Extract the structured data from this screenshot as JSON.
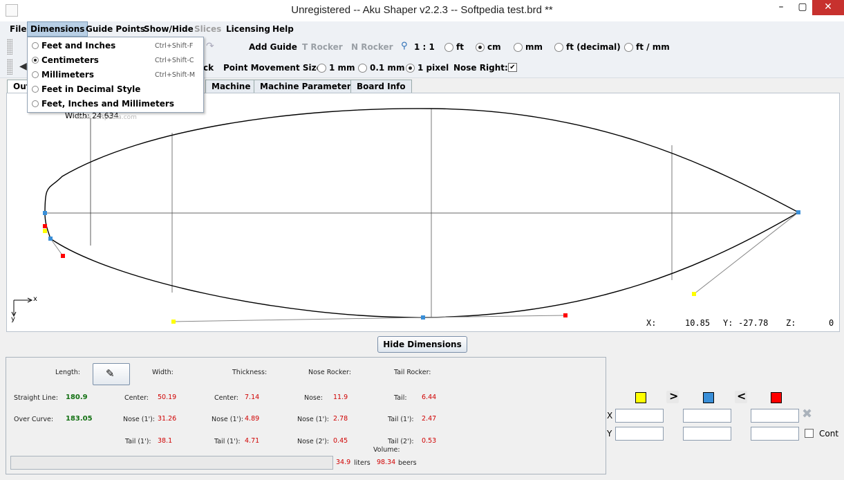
{
  "window": {
    "title": "Unregistered -- Aku Shaper v2.2.3  --  Softpedia test.brd  **",
    "minimize": "–",
    "maximize": "▢",
    "close": "✕"
  },
  "menubar": {
    "items": [
      "File",
      "Dimensions",
      "Guide Points",
      "Show/Hide",
      "Slices",
      "Licensing",
      "Help"
    ]
  },
  "dimensions_menu": {
    "items": [
      {
        "label": "Feet and Inches",
        "shortcut": "Ctrl+Shift-F",
        "selected": false
      },
      {
        "label": "Centimeters",
        "shortcut": "Ctrl+Shift-C",
        "selected": true
      },
      {
        "label": "Millimeters",
        "shortcut": "Ctrl+Shift-M",
        "selected": false
      },
      {
        "label": "Feet in Decimal Style",
        "shortcut": "",
        "selected": false
      },
      {
        "label": "Feet, Inches and Millimeters",
        "shortcut": "",
        "selected": false
      }
    ]
  },
  "toolbar1": {
    "add_guide": "Add Guide",
    "t_rocker": "T Rocker",
    "n_rocker": "N Rocker",
    "scale": "1 : 1",
    "units": [
      {
        "label": "ft",
        "selected": false
      },
      {
        "label": "cm",
        "selected": true
      },
      {
        "label": "mm",
        "selected": false
      },
      {
        "label": "ft (decimal)",
        "selected": false
      },
      {
        "label": "ft / mm",
        "selected": false
      }
    ]
  },
  "toolbar2": {
    "partial_label": "ck",
    "point_movement_label": "Point Movement Size:",
    "sizes": [
      {
        "label": "1 mm",
        "selected": false
      },
      {
        "label": "0.1 mm",
        "selected": false
      },
      {
        "label": "1 pixel",
        "selected": true
      }
    ],
    "nose_right_label": "Nose Right:",
    "nose_right_checked": "✔"
  },
  "tabs": [
    "Out",
    "Machine",
    "Machine Parameters",
    "Board Info"
  ],
  "canvas": {
    "width_label": "Width: 24.634",
    "axis_x": "x",
    "axis_y": "y",
    "readout": {
      "x_label": "X:",
      "x_value": "10.85",
      "y_label": "Y:",
      "y_value": "-27.78",
      "z_label": "Z:",
      "z_value": "0"
    }
  },
  "hide_dimensions_button": "Hide Dimensions",
  "dimensions": {
    "length_label": "Length:",
    "width_label": "Width:",
    "thickness_label": "Thickness:",
    "nose_rocker_label": "Nose Rocker:",
    "tail_rocker_label": "Tail Rocker:",
    "straight_line_label": "Straight Line:",
    "straight_line_value": "180.9",
    "over_curve_label": "Over Curve:",
    "over_curve_value": "183.05",
    "width": {
      "center_label": "Center:",
      "center": "50.19",
      "nose_label": "Nose (1'):",
      "nose": "31.26",
      "tail_label": "Tail (1'):",
      "tail": "38.1"
    },
    "thickness": {
      "center_label": "Center:",
      "center": "7.14",
      "nose_label": "Nose (1'):",
      "nose": "4.89",
      "tail_label": "Tail (1'):",
      "tail": "4.71"
    },
    "nose_rocker": {
      "nose_label": "Nose:",
      "nose": "11.9",
      "nose1_label": "Nose (1'):",
      "nose1": "2.78",
      "nose2_label": "Nose (2'):",
      "nose2": "0.45"
    },
    "tail_rocker": {
      "tail_label": "Tail:",
      "tail": "6.44",
      "tail1_label": "Tail (1'):",
      "tail1": "2.47",
      "tail2_label": "Tail (2'):",
      "tail2": "0.53"
    },
    "volume_label": "Volume:",
    "liters_value": "34.9",
    "liters_label": "liters",
    "beers_value": "98.34",
    "beers_label": "beers"
  },
  "point_editor": {
    "x_label": "X",
    "y_label": "Y",
    "cont_label": "Cont",
    "colors": {
      "yellow": "#ffff00",
      "blue": "#3a8fd8",
      "red": "#ff0000"
    }
  },
  "watermark": "www.softpedia.com"
}
